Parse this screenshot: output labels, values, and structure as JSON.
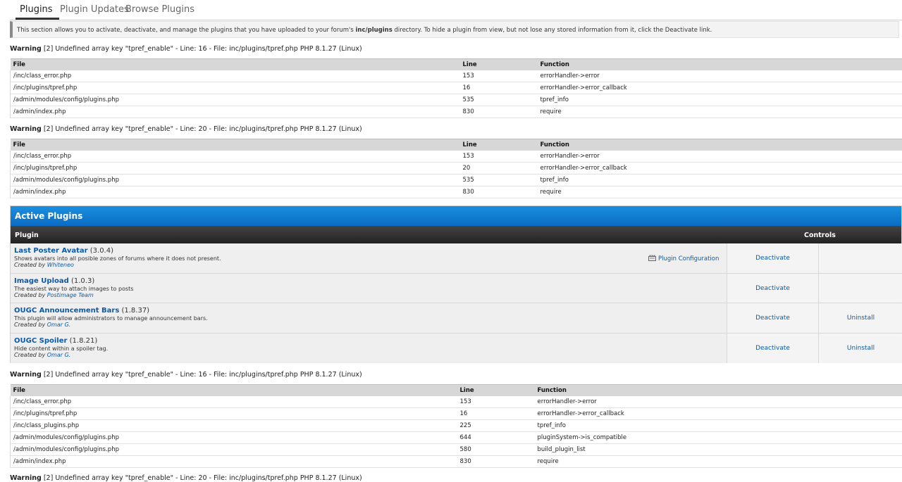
{
  "tabs": [
    {
      "label": "Plugins"
    },
    {
      "label": "Plugin Updates"
    },
    {
      "label": "Browse Plugins"
    }
  ],
  "description": {
    "before": "This section allows you to activate, deactivate, and manage the plugins that you have uploaded to your forum's ",
    "path": "inc/plugins",
    "after": " directory. To hide a plugin from view, but not lose any stored information from it, click the Deactivate link."
  },
  "warnings": [
    {
      "label": "Warning",
      "message": " [2] Undefined array key \"tpref_enable\" - Line: 16 - File: inc/plugins/tpref.php PHP 8.1.27 (Linux)"
    },
    {
      "label": "Warning",
      "message": " [2] Undefined array key \"tpref_enable\" - Line: 20 - File: inc/plugins/tpref.php PHP 8.1.27 (Linux)"
    },
    {
      "label": "Warning",
      "message": " [2] Undefined array key \"tpref_enable\" - Line: 16 - File: inc/plugins/tpref.php PHP 8.1.27 (Linux)"
    },
    {
      "label": "Warning",
      "message": " [2] Undefined array key \"tpref_enable\" - Line: 20 - File: inc/plugins/tpref.php PHP 8.1.27 (Linux)"
    }
  ],
  "trace_headers": {
    "file": "File",
    "line": "Line",
    "function": "Function"
  },
  "traces": [
    [
      {
        "file": "/inc/class_error.php",
        "line": "153",
        "function": "errorHandler->error"
      },
      {
        "file": "/inc/plugins/tpref.php",
        "line": "16",
        "function": "errorHandler->error_callback"
      },
      {
        "file": "/admin/modules/config/plugins.php",
        "line": "535",
        "function": "tpref_info"
      },
      {
        "file": "/admin/index.php",
        "line": "830",
        "function": "require"
      }
    ],
    [
      {
        "file": "/inc/class_error.php",
        "line": "153",
        "function": "errorHandler->error"
      },
      {
        "file": "/inc/plugins/tpref.php",
        "line": "20",
        "function": "errorHandler->error_callback"
      },
      {
        "file": "/admin/modules/config/plugins.php",
        "line": "535",
        "function": "tpref_info"
      },
      {
        "file": "/admin/index.php",
        "line": "830",
        "function": "require"
      }
    ],
    [
      {
        "file": "/inc/class_error.php",
        "line": "153",
        "function": "errorHandler->error"
      },
      {
        "file": "/inc/plugins/tpref.php",
        "line": "16",
        "function": "errorHandler->error_callback"
      },
      {
        "file": "/inc/class_plugins.php",
        "line": "225",
        "function": "tpref_info"
      },
      {
        "file": "/admin/modules/config/plugins.php",
        "line": "644",
        "function": "pluginSystem->is_compatible"
      },
      {
        "file": "/admin/modules/config/plugins.php",
        "line": "580",
        "function": "build_plugin_list"
      },
      {
        "file": "/admin/index.php",
        "line": "830",
        "function": "require"
      }
    ]
  ],
  "active_plugins": {
    "title": "Active Plugins",
    "col_plugin": "Plugin",
    "col_controls": "Controls",
    "created_by": "Created by ",
    "plugins": [
      {
        "name": "Last Poster Avatar",
        "version": " (3.0.4)",
        "description": "Shows avatars into all posible zones of forums where it does not present.",
        "author": "Whiteneo",
        "config": "Plugin Configuration",
        "deactivate": "Deactivate",
        "uninstall": ""
      },
      {
        "name": "Image Upload",
        "version": " (1.0.3)",
        "description": "The easiest way to attach images to posts",
        "author": "Postimage Team",
        "config": "",
        "deactivate": "Deactivate",
        "uninstall": ""
      },
      {
        "name": "OUGC Announcement Bars",
        "version": " (1.8.37)",
        "description": "This plugin will allow administrators to manage announcement bars.",
        "author": "Omar G.",
        "config": "",
        "deactivate": "Deactivate",
        "uninstall": "Uninstall"
      },
      {
        "name": "OUGC Spoiler",
        "version": " (1.8.21)",
        "description": "Hide content within a spoiler tag.",
        "author": "Omar G.",
        "config": "",
        "deactivate": "Deactivate",
        "uninstall": "Uninstall"
      }
    ]
  }
}
